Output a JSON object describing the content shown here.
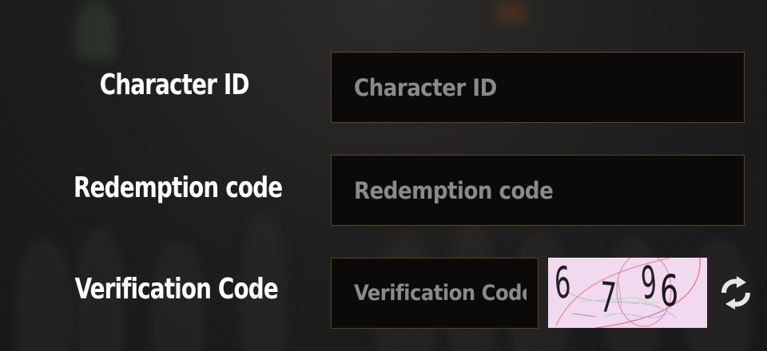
{
  "form": {
    "character_id": {
      "label": "Character ID",
      "placeholder": "Character ID",
      "value": ""
    },
    "redemption_code": {
      "label": "Redemption code",
      "placeholder": "Redemption code",
      "value": ""
    },
    "verification_code": {
      "label": "Verification Code",
      "placeholder": "Verification Code",
      "value": ""
    }
  },
  "captcha": {
    "text": "6 7 96",
    "digits": [
      "6",
      "7",
      "9",
      "6"
    ],
    "icon": "captcha-image"
  },
  "refresh": {
    "icon": "refresh-icon"
  },
  "colors": {
    "field_background": "#0b0a09",
    "field_border": "#5a4524",
    "label_text": "#ffffff",
    "placeholder_text": "#8a8a8a",
    "captcha_background": "#f1d9f0",
    "refresh_icon": "#e6e6e6"
  }
}
